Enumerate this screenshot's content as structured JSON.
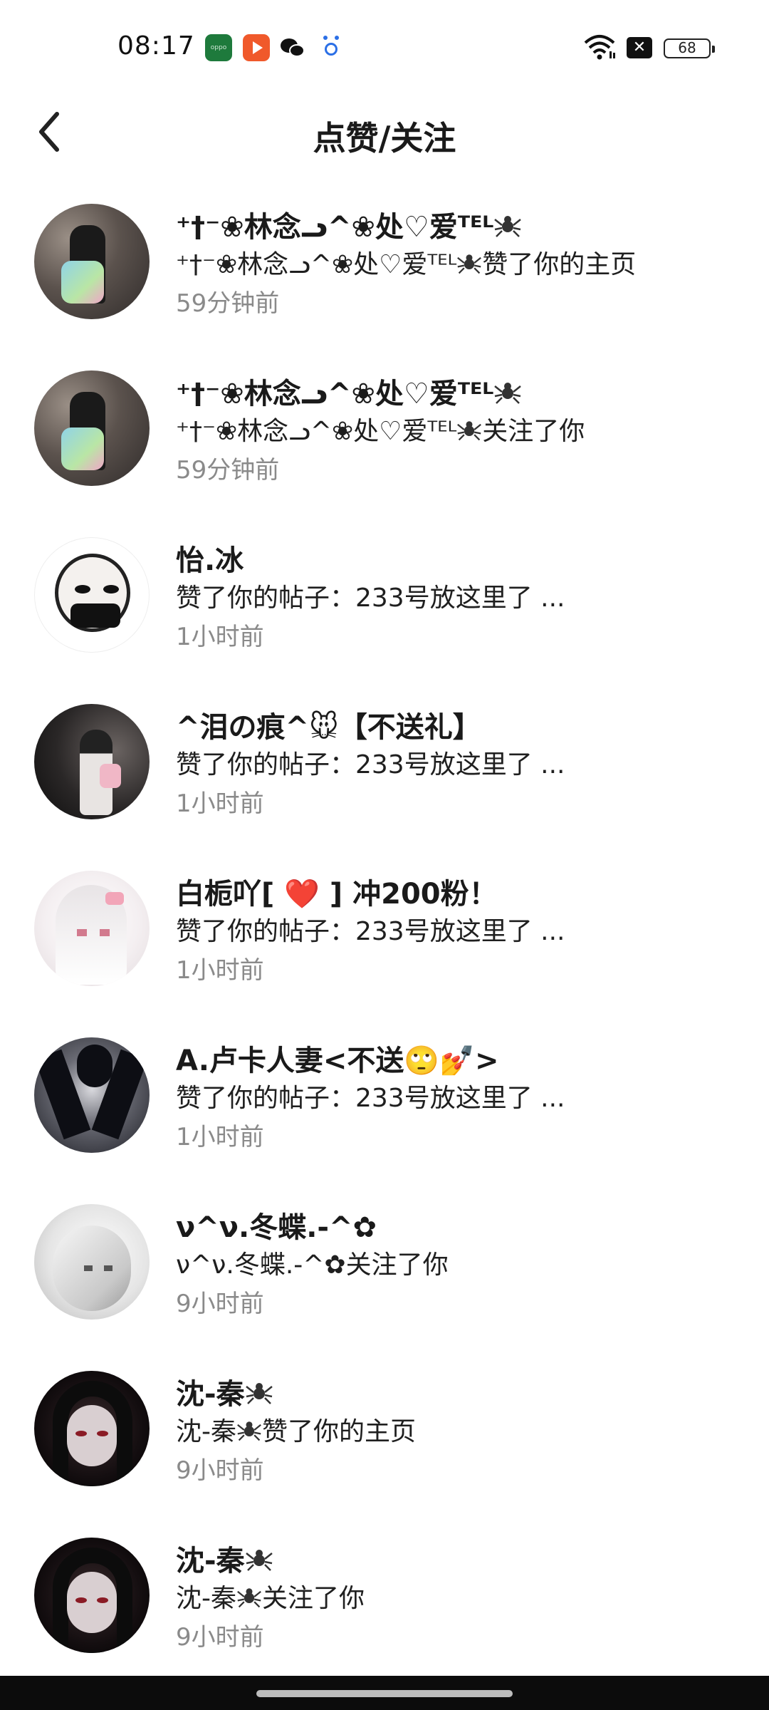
{
  "status_bar": {
    "time": "08:17",
    "apps": [
      "oppo-icon",
      "video-app-icon",
      "wechat-icon",
      "baidu-icon"
    ],
    "oppo_label": "oppo",
    "battery": "68"
  },
  "header": {
    "title": "点赞/关注"
  },
  "notifications": [
    {
      "name": "⁺†⁻❀林念ᓗ^❀处♡爱ᵀᴱᴸ",
      "action": "⁺†⁻❀林念ᓗ^❀处♡爱ᵀᴱᴸ",
      "action_suffix": "赞了你的主页",
      "time": "59分钟前"
    },
    {
      "name": "⁺†⁻❀林念ᓗ^❀处♡爱ᵀᴱᴸ",
      "action": "⁺†⁻❀林念ᓗ^❀处♡爱ᵀᴱᴸ",
      "action_suffix": "关注了你",
      "time": "59分钟前"
    },
    {
      "name": "怡.冰",
      "action": "赞了你的帖子：233号放这里了 ...",
      "time": "1小时前"
    },
    {
      "name": "^泪の痕^🐭【不送礼】",
      "action": "赞了你的帖子：233号放这里了 ...",
      "time": "1小时前"
    },
    {
      "name": "白栀吖[ ❤️ ] 冲200粉！",
      "action": "赞了你的帖子：233号放这里了 ...",
      "time": "1小时前"
    },
    {
      "name": "A.卢卡人妻<不送🙄💅>",
      "action": "赞了你的帖子：233号放这里了 ...",
      "time": "1小时前"
    },
    {
      "name": "ν^ν.冬蝶.-^✿",
      "action": "ν^ν.冬蝶.-^✿关注了你",
      "time": "9小时前"
    },
    {
      "name": "沈-秦",
      "action": "沈-秦",
      "action_suffix": "赞了你的主页",
      "time": "9小时前"
    },
    {
      "name": "沈-秦",
      "action": "沈-秦",
      "action_suffix": "关注了你",
      "time": "9小时前"
    }
  ],
  "colors": {
    "text": "#1a1a1a",
    "secondary_text": "#8a8a8a",
    "nav_bar": "#0c0c0c"
  }
}
